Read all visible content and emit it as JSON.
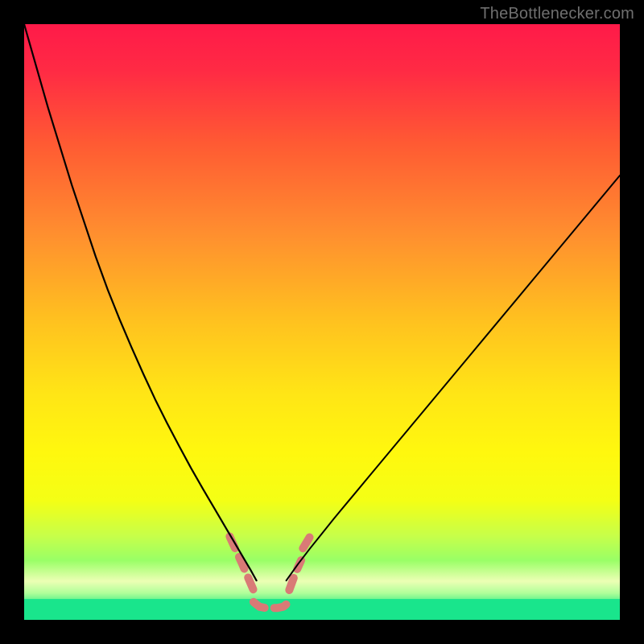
{
  "watermark": "TheBottlenecker.com",
  "chart_data": {
    "type": "line",
    "title": "",
    "xlabel": "",
    "ylabel": "",
    "xlim": [
      0,
      100
    ],
    "ylim": [
      0,
      100
    ],
    "gradient_stops": [
      {
        "offset": 0.0,
        "color": "#ff1a49"
      },
      {
        "offset": 0.08,
        "color": "#ff2b44"
      },
      {
        "offset": 0.2,
        "color": "#ff5a33"
      },
      {
        "offset": 0.35,
        "color": "#ff8e2f"
      },
      {
        "offset": 0.5,
        "color": "#ffc21f"
      },
      {
        "offset": 0.62,
        "color": "#ffe516"
      },
      {
        "offset": 0.72,
        "color": "#fff80e"
      },
      {
        "offset": 0.8,
        "color": "#f4ff15"
      },
      {
        "offset": 0.86,
        "color": "#c6ff4a"
      },
      {
        "offset": 0.9,
        "color": "#99ff66"
      },
      {
        "offset": 0.935,
        "color": "#ecffb4"
      },
      {
        "offset": 0.955,
        "color": "#b0ff9a"
      },
      {
        "offset": 0.97,
        "color": "#55f08a"
      },
      {
        "offset": 0.985,
        "color": "#25e68a"
      },
      {
        "offset": 1.0,
        "color": "#19e58c"
      }
    ],
    "series": [
      {
        "name": "left-curve",
        "color": "#000000",
        "width": 2.2,
        "x": [
          0,
          2,
          4,
          6,
          8,
          10,
          12,
          14,
          16,
          18,
          20,
          22,
          24,
          26,
          28,
          30,
          31,
          32,
          33,
          34,
          35,
          36,
          37,
          38,
          38.5,
          39
        ],
        "y": [
          100,
          93,
          86,
          79.5,
          73,
          67,
          61,
          55.5,
          50.5,
          45.8,
          41.3,
          37,
          33,
          29.2,
          25.5,
          22,
          20.3,
          18.6,
          16.9,
          15.2,
          13.5,
          11.8,
          10.1,
          8.4,
          7.5,
          6.6
        ]
      },
      {
        "name": "right-curve",
        "color": "#000000",
        "width": 2.0,
        "x": [
          44,
          45,
          46,
          48,
          50,
          52,
          54,
          56,
          58,
          60,
          63,
          66,
          70,
          74,
          78,
          82,
          86,
          90,
          94,
          98,
          100
        ],
        "y": [
          6.6,
          8.0,
          9.4,
          12.0,
          14.5,
          17.0,
          19.4,
          21.8,
          24.2,
          26.6,
          30.2,
          33.8,
          38.6,
          43.4,
          48.2,
          53.0,
          57.8,
          62.6,
          67.4,
          72.2,
          74.6
        ]
      }
    ],
    "bottom_band": {
      "color": "#19e58c",
      "y": 3.5
    },
    "dashed_segments": {
      "color": "#d97a76",
      "width": 10,
      "dash": [
        16,
        12
      ],
      "paths": [
        {
          "x": [
            34.5,
            36.6,
            38.5
          ],
          "y": [
            14.0,
            9.4,
            5.0
          ]
        },
        {
          "x": [
            38.5,
            39.5,
            40.5,
            41.5,
            42.5,
            43.5,
            44.5
          ],
          "y": [
            3.0,
            2.2,
            2.0,
            2.0,
            2.0,
            2.2,
            3.0
          ]
        },
        {
          "x": [
            44.5,
            45.6,
            46.5
          ],
          "y": [
            5.0,
            8.0,
            10.0
          ]
        },
        {
          "x": [
            46.8,
            48.0
          ],
          "y": [
            12.0,
            14.0
          ]
        }
      ]
    }
  }
}
